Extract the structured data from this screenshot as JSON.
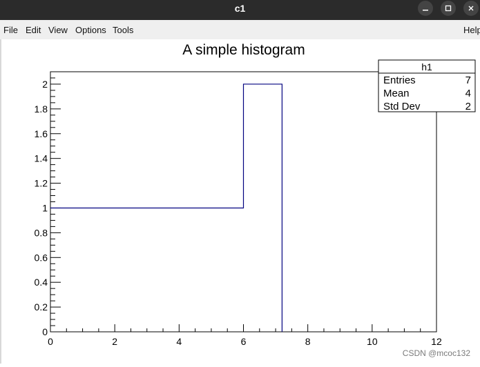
{
  "window": {
    "title": "c1"
  },
  "menu": {
    "file_label": "File",
    "edit_label": "Edit",
    "view_label": "View",
    "options_label": "Options",
    "tools_label": "Tools",
    "help_label": "Help"
  },
  "stats": {
    "name": "h1",
    "rows": [
      {
        "label": "Entries",
        "value": "7"
      },
      {
        "label": "Mean",
        "value": "4"
      },
      {
        "label": "Std Dev",
        "value": "2"
      }
    ]
  },
  "watermark": "CSDN @mcoc132",
  "colors": {
    "histogram_line": "#00007f",
    "titlebar": "#2b2b2b"
  },
  "icons": {
    "minimize": "minimize-icon",
    "maximize": "maximize-icon",
    "close": "close-icon"
  },
  "chart_data": {
    "type": "bar",
    "title": "A simple histogram",
    "xlabel": "",
    "ylabel": "",
    "xlim": [
      0,
      12
    ],
    "ylim": [
      0,
      2.1
    ],
    "bins": [
      {
        "x0": 0,
        "x1": 6,
        "value": 1
      },
      {
        "x0": 6,
        "x1": 7.2,
        "value": 2
      }
    ],
    "x_ticks": [
      "0",
      "2",
      "4",
      "6",
      "8",
      "10",
      "12"
    ],
    "y_ticks": [
      "0",
      "0.2",
      "0.4",
      "0.6",
      "0.8",
      "1",
      "1.2",
      "1.4",
      "1.6",
      "1.8",
      "2"
    ],
    "grid": false
  }
}
